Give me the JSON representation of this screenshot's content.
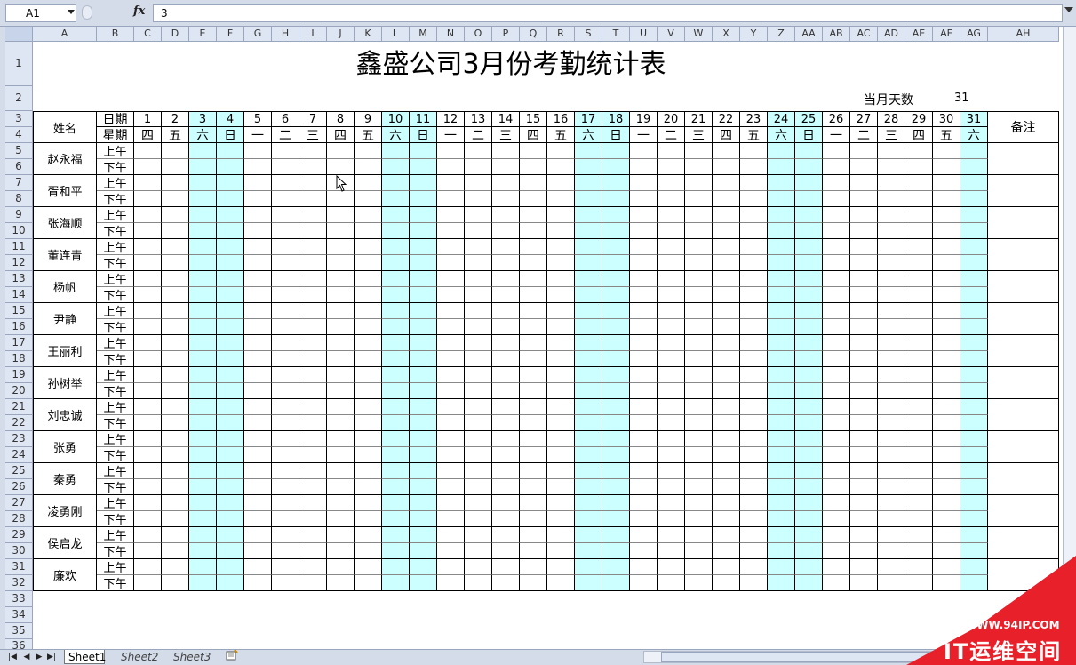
{
  "formula_bar": {
    "cell_ref": "A1",
    "content": "3",
    "fx_symbol": "fx"
  },
  "columns": [
    "A",
    "B",
    "C",
    "D",
    "E",
    "F",
    "G",
    "H",
    "I",
    "J",
    "K",
    "L",
    "M",
    "N",
    "O",
    "P",
    "Q",
    "R",
    "S",
    "T",
    "U",
    "V",
    "W",
    "X",
    "Y",
    "Z",
    "AA",
    "AB",
    "AC",
    "AD",
    "AE",
    "AF",
    "AG",
    "AH"
  ],
  "rows": [
    "1",
    "2",
    "3",
    "4",
    "5",
    "6",
    "7",
    "8",
    "9",
    "10",
    "11",
    "12",
    "13",
    "14",
    "15",
    "16",
    "17",
    "18",
    "19",
    "20",
    "21",
    "22",
    "23",
    "24",
    "25",
    "26",
    "27",
    "28",
    "29",
    "30",
    "31",
    "32",
    "33",
    "34",
    "35",
    "36"
  ],
  "sheet": {
    "title": "鑫盛公司3月份考勤统计表",
    "days_label": "当月天数",
    "days_value": "31",
    "header_name": "姓名",
    "header_date": "日期",
    "header_weekday": "星期",
    "header_note": "备注",
    "days": [
      "1",
      "2",
      "3",
      "4",
      "5",
      "6",
      "7",
      "8",
      "9",
      "10",
      "11",
      "12",
      "13",
      "14",
      "15",
      "16",
      "17",
      "18",
      "19",
      "20",
      "21",
      "22",
      "23",
      "24",
      "25",
      "26",
      "27",
      "28",
      "29",
      "30",
      "31"
    ],
    "weekdays": [
      "四",
      "五",
      "六",
      "日",
      "一",
      "二",
      "三",
      "四",
      "五",
      "六",
      "日",
      "一",
      "二",
      "三",
      "四",
      "五",
      "六",
      "日",
      "一",
      "二",
      "三",
      "四",
      "五",
      "六",
      "日",
      "一",
      "二",
      "三",
      "四",
      "五",
      "六"
    ],
    "weekend_highlight_color": "#ccffff",
    "morning": "上午",
    "afternoon": "下午",
    "employees": [
      "赵永福",
      "胥和平",
      "张海顺",
      "董连青",
      "杨帆",
      "尹静",
      "王丽利",
      "孙树举",
      "刘忠诚",
      "张勇",
      "秦勇",
      "凌勇刚",
      "侯启龙",
      "廉欢"
    ]
  },
  "sheet_tabs": [
    "Sheet1",
    "Sheet2",
    "Sheet3"
  ],
  "watermark": {
    "url": "WWW.94IP.COM",
    "brand": "IT运维空间",
    "color": "#e8202a"
  }
}
